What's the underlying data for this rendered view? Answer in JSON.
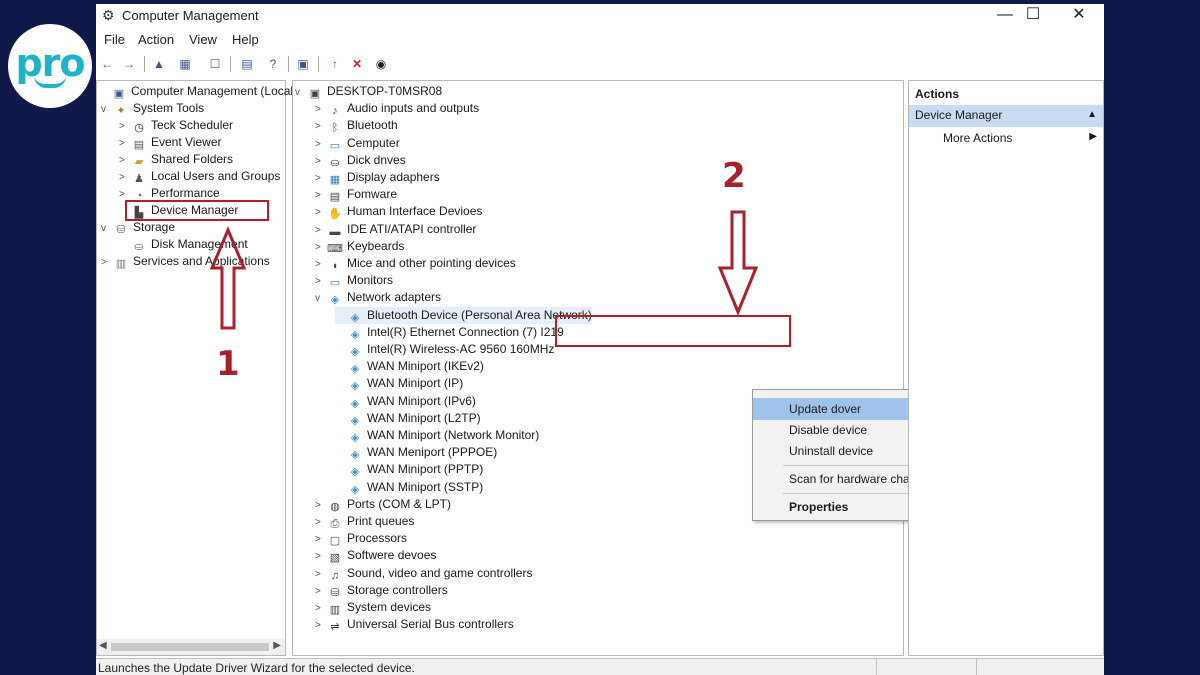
{
  "window": {
    "title": "Computer Management",
    "controls": [
      "—",
      "☐",
      "✕"
    ]
  },
  "menu": [
    "File",
    "Action",
    "View",
    "Help"
  ],
  "tree": [
    {
      "label": "Computer Management (Local",
      "expander": "",
      "icon": "computer-icon"
    },
    {
      "label": "System Tools",
      "expander": "v",
      "icon": "tools-icon"
    },
    {
      "label": "Teck Scheduler",
      "expander": ">",
      "icon": "clock-icon"
    },
    {
      "label": "Event Viewer",
      "expander": ">",
      "icon": "event-icon"
    },
    {
      "label": "Shared Folders",
      "expander": ">",
      "icon": "folder-icon"
    },
    {
      "label": "Local Users and Groups",
      "expander": ">",
      "icon": "users-icon"
    },
    {
      "label": "Performance",
      "expander": ">",
      "icon": "performance-icon"
    },
    {
      "label": "Device Manager",
      "expander": "",
      "icon": "device-manager-icon"
    },
    {
      "label": "Storage",
      "expander": "v",
      "icon": "storage-icon"
    },
    {
      "label": "Disk Management",
      "expander": "",
      "icon": "disk-icon"
    },
    {
      "label": "Services and Applications",
      "expander": ">",
      "icon": "services-icon"
    }
  ],
  "devices": [
    {
      "label": "DESKTOP-T0MSR08",
      "expander": "v",
      "icon": "computer-icon"
    },
    {
      "label": "Audio inputs and outputs",
      "expander": ">",
      "icon": "audio-icon"
    },
    {
      "label": "Bluetooth",
      "expander": ">",
      "icon": "bluetooth-icon"
    },
    {
      "label": "Cemputer",
      "expander": ">",
      "icon": "monitor-icon"
    },
    {
      "label": "Dick dnves",
      "expander": ">",
      "icon": "disk-icon"
    },
    {
      "label": "Display adaphers",
      "expander": ">",
      "icon": "display-icon"
    },
    {
      "label": "Fomware",
      "expander": ">",
      "icon": "firmware-icon"
    },
    {
      "label": "Human Interface Devioes",
      "expander": ">",
      "icon": "hid-icon"
    },
    {
      "label": "IDE ATI/ATAPI controller",
      "expander": ">",
      "icon": "ide-icon"
    },
    {
      "label": "Keybeards",
      "expander": ">",
      "icon": "keyboard-icon"
    },
    {
      "label": "Mice and other pointing devices",
      "expander": ">",
      "icon": "mouse-icon"
    },
    {
      "label": "Monitors",
      "expander": ">",
      "icon": "monitor-icon"
    },
    {
      "label": "Network adapters",
      "expander": "v",
      "icon": "network-icon"
    },
    {
      "label": "Bluetooth Device (Personal Area Network)",
      "expander": "",
      "icon": "network-icon"
    },
    {
      "label": "Intel(R) Ethernet Connection (7) I219",
      "expander": "",
      "icon": "network-icon"
    },
    {
      "label": "Intel(R) Wireless-AC 9560 160MHz",
      "expander": "",
      "icon": "network-icon"
    },
    {
      "label": "WAN Miniport (IKEv2)",
      "expander": "",
      "icon": "network-icon"
    },
    {
      "label": "WAN Miniport (IP)",
      "expander": "",
      "icon": "network-icon"
    },
    {
      "label": "WAN Miniport (IPv6)",
      "expander": "",
      "icon": "network-icon"
    },
    {
      "label": "WAN Miniport (L2TP)",
      "expander": "",
      "icon": "network-icon"
    },
    {
      "label": "WAN Miniport (Network Monitor)",
      "expander": "",
      "icon": "network-icon"
    },
    {
      "label": "WAN Meniport (PPPOE)",
      "expander": "",
      "icon": "network-icon"
    },
    {
      "label": "WAN Miniport (PPTP)",
      "expander": "",
      "icon": "network-icon"
    },
    {
      "label": "WAN Miniport (SSTP)",
      "expander": "",
      "icon": "network-icon"
    },
    {
      "label": "Ports (COM & LPT)",
      "expander": ">",
      "icon": "port-icon"
    },
    {
      "label": "Print queues",
      "expander": ">",
      "icon": "printer-icon"
    },
    {
      "label": "Processors",
      "expander": ">",
      "icon": "processor-icon"
    },
    {
      "label": "Softwere devoes",
      "expander": ">",
      "icon": "software-icon"
    },
    {
      "label": "Sound, video and game controllers",
      "expander": ">",
      "icon": "sound-icon"
    },
    {
      "label": "Storage controllers",
      "expander": ">",
      "icon": "storage-icon"
    },
    {
      "label": "System devices",
      "expander": ">",
      "icon": "system-icon"
    },
    {
      "label": "Universal Serial Bus controllers",
      "expander": ">",
      "icon": "usb-icon"
    }
  ],
  "context_menu": {
    "update": "Update dover",
    "disable": "Disable device",
    "uninstall": "Uninstall device",
    "scan": "Scan for hardware changes",
    "properties": "Properties"
  },
  "actions": {
    "title": "Actions",
    "selected": "Device Manager",
    "more": "More Actions"
  },
  "status": "Launches the Update Driver Wizard for the selected device.",
  "annotations": {
    "step1": "1",
    "step2": "2",
    "color": "#a5222c"
  },
  "brand": {
    "logo_text": "pro",
    "color": "#1fb3c8"
  }
}
